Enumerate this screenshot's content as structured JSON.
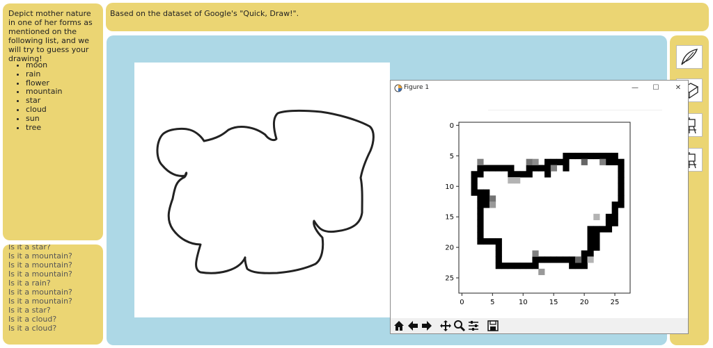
{
  "instructions": {
    "text": "Depict mother nature in one of her forms as mentioned on the following list, and we will try to guess your drawing!",
    "items": [
      "moon",
      "rain",
      "flower",
      "mountain",
      "star",
      "cloud",
      "sun",
      "tree"
    ]
  },
  "header": {
    "text": "Based on the dataset of Google's \"Quick, Draw!\"."
  },
  "history": {
    "items": [
      "Is it a star?",
      "Is it a mountain?",
      "Is it a mountain?",
      "Is it a mountain?",
      "Is it a rain?",
      "Is it a mountain?",
      "Is it a mountain?",
      "Is it a star?",
      "Is it a cloud?",
      "Is it a cloud?"
    ]
  },
  "figure": {
    "title": "Figure 1",
    "x_ticks": [
      "0",
      "5",
      "10",
      "15",
      "20",
      "25"
    ],
    "y_ticks": [
      "0",
      "5",
      "10",
      "15",
      "20",
      "25"
    ]
  },
  "tools": [
    "pen-icon",
    "eraser-icon",
    "easel-icon",
    "easel-icon"
  ],
  "colors": {
    "panel": "#ebd573",
    "canvas_bg": "#add8e6"
  }
}
